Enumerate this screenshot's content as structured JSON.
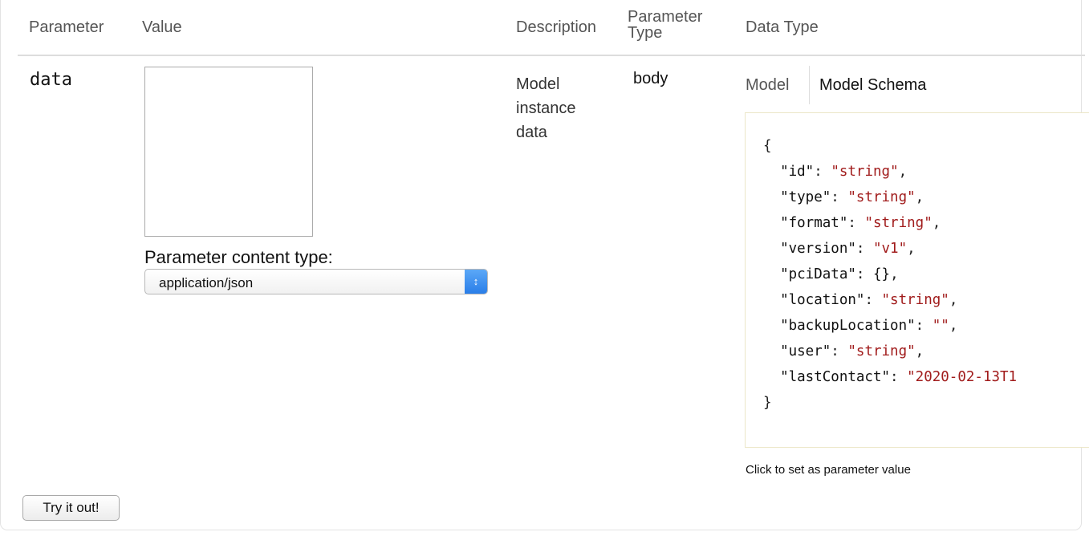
{
  "headers": {
    "parameter": "Parameter",
    "value": "Value",
    "description": "Description",
    "parameter_type_line1": "Parameter",
    "parameter_type_line2": "Type",
    "data_type": "Data Type"
  },
  "row": {
    "name": "data",
    "value": "",
    "content_type_label": "Parameter content type:",
    "content_type_selected": "application/json",
    "description_lines": [
      "Model",
      "instance",
      "data"
    ],
    "parameter_type": "body"
  },
  "data_type": {
    "tabs": [
      "Model",
      "Model Schema"
    ],
    "schema_lines": [
      {
        "punct_open": "{"
      },
      {
        "key": "\"id\"",
        "value": "\"string\"",
        "sep": ","
      },
      {
        "key": "\"type\"",
        "value": "\"string\"",
        "sep": ","
      },
      {
        "key": "\"format\"",
        "value": "\"string\"",
        "sep": ","
      },
      {
        "key": "\"version\"",
        "value": "\"v1\"",
        "sep": ","
      },
      {
        "key": "\"pciData\"",
        "raw": "{}",
        "sep": ","
      },
      {
        "key": "\"location\"",
        "value": "\"string\"",
        "sep": ","
      },
      {
        "key": "\"backupLocation\"",
        "value": "\"\"",
        "sep": ","
      },
      {
        "key": "\"user\"",
        "value": "\"string\"",
        "sep": ","
      },
      {
        "key": "\"lastContact\"",
        "value": "\"2020-02-13T1",
        "sep": ""
      },
      {
        "punct_close": "}"
      }
    ],
    "hint": "Click to set as parameter value"
  },
  "actions": {
    "try_label": "Try it out!"
  },
  "colors": {
    "string_value": "#a11c1c",
    "select_arrow": "#2a7ee8"
  }
}
